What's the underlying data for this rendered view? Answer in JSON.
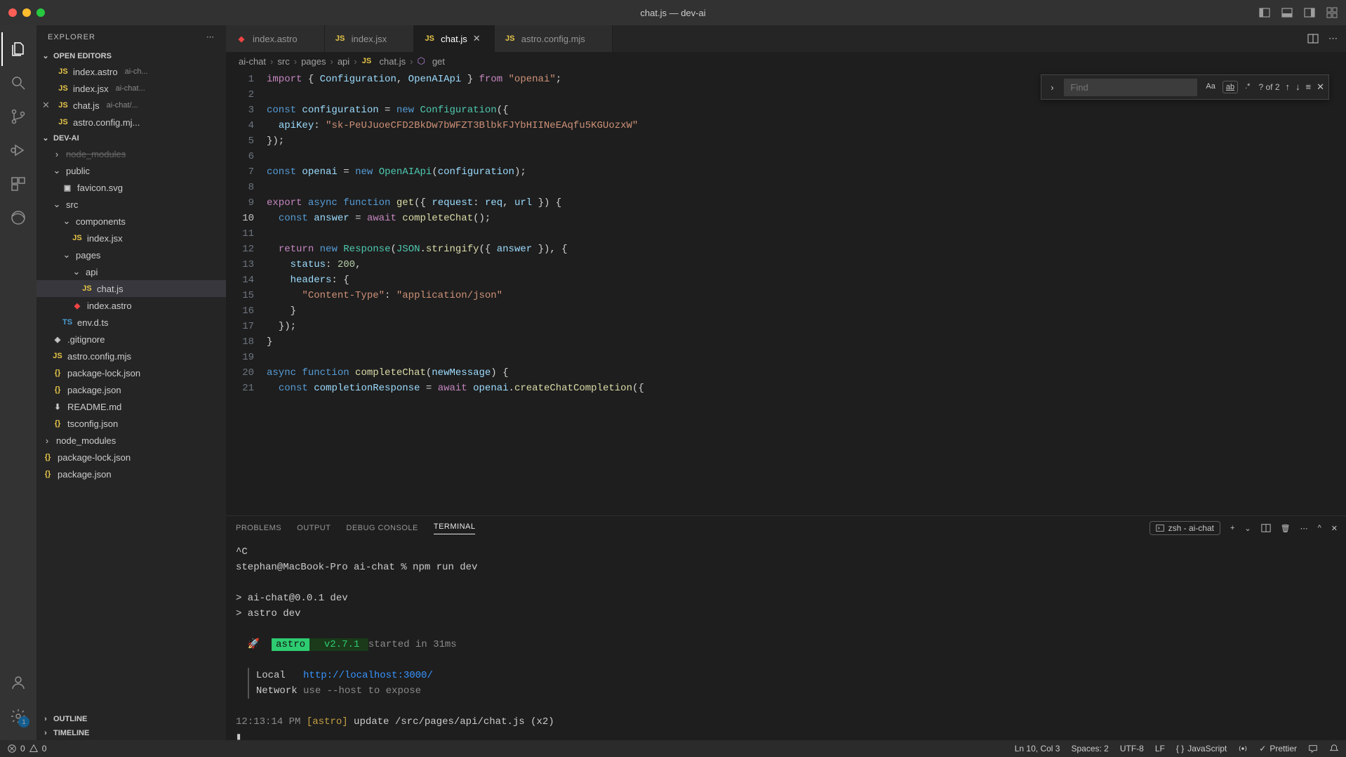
{
  "window": {
    "title": "chat.js — dev-ai"
  },
  "sidebar": {
    "title": "EXPLORER",
    "openEditors": {
      "label": "OPEN EDITORS",
      "items": [
        {
          "name": "index.astro",
          "dim": "ai-ch..."
        },
        {
          "name": "index.jsx",
          "dim": "ai-chat..."
        },
        {
          "name": "chat.js",
          "dim": "ai-chat/...",
          "active": true
        },
        {
          "name": "astro.config.mj...",
          "dim": ""
        }
      ]
    },
    "project": {
      "label": "DEV-AI",
      "tree": [
        {
          "depth": 1,
          "type": "folder-cut",
          "name": "node_modules"
        },
        {
          "depth": 1,
          "type": "folder",
          "open": true,
          "name": "public"
        },
        {
          "depth": 2,
          "type": "file",
          "icon": "svg",
          "name": "favicon.svg"
        },
        {
          "depth": 1,
          "type": "folder",
          "open": true,
          "name": "src"
        },
        {
          "depth": 2,
          "type": "folder",
          "open": true,
          "name": "components"
        },
        {
          "depth": 3,
          "type": "file",
          "icon": "js",
          "name": "index.jsx"
        },
        {
          "depth": 2,
          "type": "folder",
          "open": true,
          "name": "pages"
        },
        {
          "depth": 3,
          "type": "folder",
          "open": true,
          "name": "api"
        },
        {
          "depth": 4,
          "type": "file",
          "icon": "js",
          "name": "chat.js",
          "selected": true
        },
        {
          "depth": 3,
          "type": "file",
          "icon": "astro",
          "name": "index.astro"
        },
        {
          "depth": 2,
          "type": "file",
          "icon": "ts",
          "name": "env.d.ts"
        },
        {
          "depth": 1,
          "type": "file",
          "icon": "git",
          "name": ".gitignore"
        },
        {
          "depth": 1,
          "type": "file",
          "icon": "js",
          "name": "astro.config.mjs"
        },
        {
          "depth": 1,
          "type": "file",
          "icon": "json",
          "name": "package-lock.json"
        },
        {
          "depth": 1,
          "type": "file",
          "icon": "json",
          "name": "package.json"
        },
        {
          "depth": 1,
          "type": "file",
          "icon": "md",
          "name": "README.md"
        },
        {
          "depth": 1,
          "type": "file",
          "icon": "json",
          "name": "tsconfig.json"
        },
        {
          "depth": 0,
          "type": "folder",
          "open": false,
          "name": "node_modules"
        },
        {
          "depth": 0,
          "type": "file",
          "icon": "json",
          "name": "package-lock.json"
        },
        {
          "depth": 0,
          "type": "file",
          "icon": "json",
          "name": "package.json"
        }
      ]
    },
    "outline": "OUTLINE",
    "timeline": "TIMELINE"
  },
  "tabs": [
    {
      "name": "index.astro",
      "icon": "astro"
    },
    {
      "name": "index.jsx",
      "icon": "js"
    },
    {
      "name": "chat.js",
      "icon": "js",
      "active": true
    },
    {
      "name": "astro.config.mjs",
      "icon": "js"
    }
  ],
  "breadcrumbs": [
    "ai-chat",
    "src",
    "pages",
    "api",
    "chat.js",
    "get"
  ],
  "find": {
    "placeholder": "Find",
    "count": "? of 2"
  },
  "editor": {
    "currentLine": 10,
    "lines": [
      {
        "n": 1,
        "html": "<span class='tk-kw'>import</span> <span class='tk-pun'>{</span> <span class='tk-var'>Configuration</span><span class='tk-pun'>,</span> <span class='tk-var'>OpenAIApi</span> <span class='tk-pun'>}</span> <span class='tk-kw'>from</span> <span class='tk-str'>\"openai\"</span><span class='tk-pun'>;</span>"
      },
      {
        "n": 2,
        "html": ""
      },
      {
        "n": 3,
        "html": "<span class='tk-kw2'>const</span> <span class='tk-var'>configuration</span> <span class='tk-pun'>=</span> <span class='tk-kw2'>new</span> <span class='tk-cls'>Configuration</span><span class='tk-pun'>({</span>"
      },
      {
        "n": 4,
        "html": "  <span class='tk-var'>apiKey</span><span class='tk-pun'>:</span> <span class='tk-str'>\"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\"</span>"
      },
      {
        "n": 5,
        "html": "<span class='tk-pun'>});</span>"
      },
      {
        "n": 6,
        "html": ""
      },
      {
        "n": 7,
        "html": "<span class='tk-kw2'>const</span> <span class='tk-var'>openai</span> <span class='tk-pun'>=</span> <span class='tk-kw2'>new</span> <span class='tk-cls'>OpenAIApi</span><span class='tk-pun'>(</span><span class='tk-var'>configuration</span><span class='tk-pun'>);</span>"
      },
      {
        "n": 8,
        "html": ""
      },
      {
        "n": 9,
        "html": "<span class='tk-kw'>export</span> <span class='tk-kw2'>async</span> <span class='tk-kw2'>function</span> <span class='tk-fn'>get</span><span class='tk-pun'>({</span> <span class='tk-var'>request</span><span class='tk-pun'>:</span> <span class='tk-var'>req</span><span class='tk-pun'>,</span> <span class='tk-var'>url</span> <span class='tk-pun'>}) {</span>"
      },
      {
        "n": 10,
        "html": "  <span class='tk-kw2'>const</span> <span class='tk-var'>answer</span> <span class='tk-pun'>=</span> <span class='tk-kw'>await</span> <span class='tk-fn'>completeChat</span><span class='tk-pun'>();</span>"
      },
      {
        "n": 11,
        "html": ""
      },
      {
        "n": 12,
        "html": "  <span class='tk-kw'>return</span> <span class='tk-kw2'>new</span> <span class='tk-cls'>Response</span><span class='tk-pun'>(</span><span class='tk-cls'>JSON</span><span class='tk-pun'>.</span><span class='tk-fn'>stringify</span><span class='tk-pun'>({</span> <span class='tk-var'>answer</span> <span class='tk-pun'>}), {</span>"
      },
      {
        "n": 13,
        "html": "    <span class='tk-var'>status</span><span class='tk-pun'>:</span> <span class='tk-num'>200</span><span class='tk-pun'>,</span>"
      },
      {
        "n": 14,
        "html": "    <span class='tk-var'>headers</span><span class='tk-pun'>:</span> <span class='tk-pun'>{</span>"
      },
      {
        "n": 15,
        "html": "      <span class='tk-str'>\"Content-Type\"</span><span class='tk-pun'>:</span> <span class='tk-str'>\"application/json\"</span>"
      },
      {
        "n": 16,
        "html": "    <span class='tk-pun'>}</span>"
      },
      {
        "n": 17,
        "html": "  <span class='tk-pun'>});</span>"
      },
      {
        "n": 18,
        "html": "<span class='tk-pun'>}</span>"
      },
      {
        "n": 19,
        "html": ""
      },
      {
        "n": 20,
        "html": "<span class='tk-kw2'>async</span> <span class='tk-kw2'>function</span> <span class='tk-fn'>completeChat</span><span class='tk-pun'>(</span><span class='tk-var'>newMessage</span><span class='tk-pun'>) {</span>"
      },
      {
        "n": 21,
        "html": "  <span class='tk-kw2'>const</span> <span class='tk-var'>completionResponse</span> <span class='tk-pun'>=</span> <span class='tk-kw'>await</span> <span class='tk-var'>openai</span><span class='tk-pun'>.</span><span class='tk-fn'>createChatCompletion</span><span class='tk-pun'>({</span>"
      }
    ]
  },
  "panel": {
    "tabs": [
      "PROBLEMS",
      "OUTPUT",
      "DEBUG CONSOLE",
      "TERMINAL"
    ],
    "activeTab": 3,
    "termLabel": "zsh - ai-chat",
    "terminal": {
      "l1": "^C",
      "l2": "stephan@MacBook-Pro ai-chat % npm run dev",
      "l3": "",
      "l4": "> ai-chat@0.0.1 dev",
      "l5": "> astro dev",
      "l6": "",
      "l7a": "  🚀  ",
      "l7b": "astro",
      "l7c": "  v2.7.1 ",
      "l7d": "started in 31ms",
      "l8": "",
      "l9a": "Local   ",
      "l9b": "http://localhost:3000/",
      "l10a": "Network ",
      "l10b": "use --host to expose",
      "l11a": "12:13:14 PM ",
      "l11b": "[astro]",
      "l11c": " update ",
      "l11d": "/src/pages/api/chat.js (x2)"
    }
  },
  "statusbar": {
    "errors": "0",
    "warnings": "0",
    "lncol": "Ln 10, Col 3",
    "spaces": "Spaces: 2",
    "encoding": "UTF-8",
    "eol": "LF",
    "lang": "JavaScript",
    "prettier": "Prettier"
  }
}
